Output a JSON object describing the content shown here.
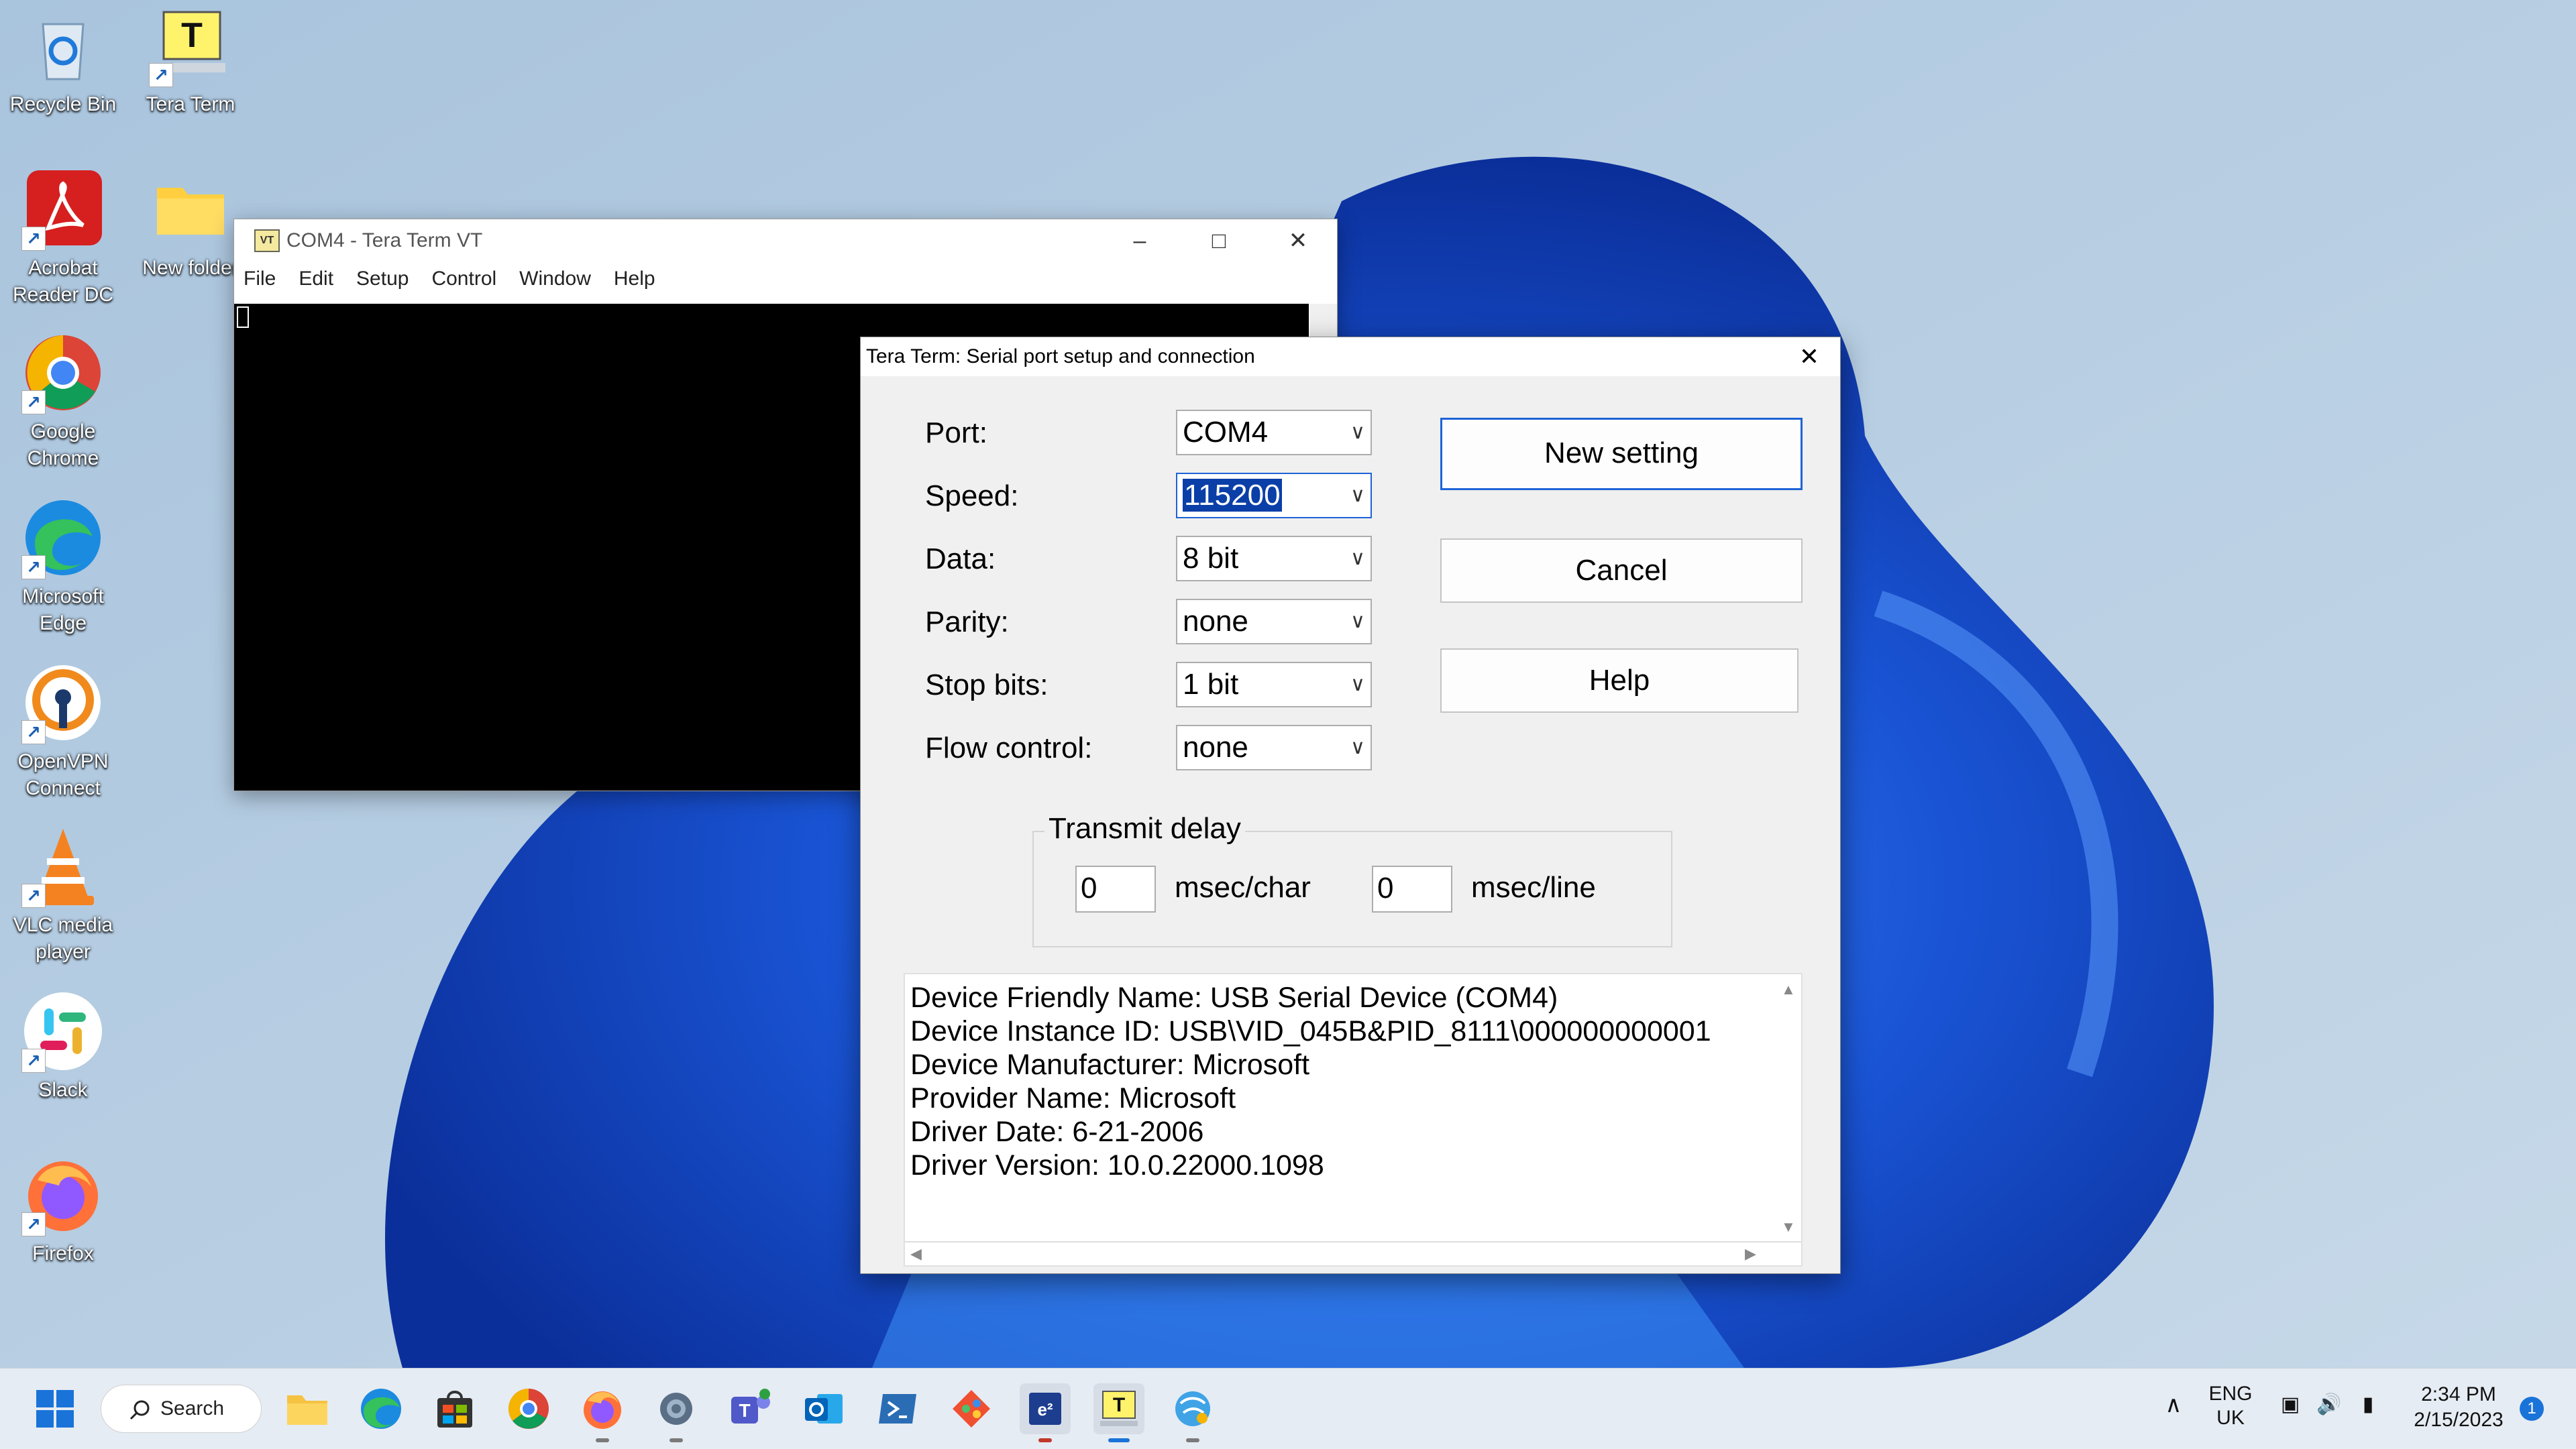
{
  "desktop_icons": [
    {
      "name": "recycle-bin",
      "label": "Recycle Bin"
    },
    {
      "name": "tera-term",
      "label": "Tera Term"
    },
    {
      "name": "acrobat",
      "label": "Acrobat Reader DC"
    },
    {
      "name": "new-folder",
      "label": "New folder"
    },
    {
      "name": "chrome",
      "label": "Google Chrome"
    },
    {
      "name": "edge",
      "label": "Microsoft Edge"
    },
    {
      "name": "openvpn",
      "label": "OpenVPN Connect"
    },
    {
      "name": "vlc",
      "label": "VLC media player"
    },
    {
      "name": "slack",
      "label": "Slack"
    },
    {
      "name": "firefox",
      "label": "Firefox"
    }
  ],
  "teraterm": {
    "title": "COM4 - Tera Term VT",
    "menu": [
      "File",
      "Edit",
      "Setup",
      "Control",
      "Window",
      "Help"
    ]
  },
  "dialog": {
    "title": "Tera Term: Serial port setup and connection",
    "fields": [
      {
        "label": "Port:",
        "value": "COM4"
      },
      {
        "label": "Speed:",
        "value": "115200"
      },
      {
        "label": "Data:",
        "value": "8 bit"
      },
      {
        "label": "Parity:",
        "value": "none"
      },
      {
        "label": "Stop bits:",
        "value": "1 bit"
      },
      {
        "label": "Flow control:",
        "value": "none"
      }
    ],
    "buttons": {
      "new_setting": "New setting",
      "cancel": "Cancel",
      "help": "Help"
    },
    "transmit_delay": {
      "label": "Transmit delay",
      "char_value": "0",
      "char_unit": "msec/char",
      "line_value": "0",
      "line_unit": "msec/line"
    },
    "info_lines": [
      "Device Friendly Name: USB Serial Device (COM4)",
      "Device Instance ID: USB\\VID_045B&PID_8111\\000000000001",
      "Device Manufacturer: Microsoft",
      "Provider Name: Microsoft",
      "Driver Date: 6-21-2006",
      "Driver Version: 10.0.22000.1098"
    ]
  },
  "taskbar": {
    "search_label": "Search",
    "language": "ENG",
    "region": "UK",
    "time": "2:34 PM",
    "date": "2/15/2023",
    "notification_count": "1"
  }
}
